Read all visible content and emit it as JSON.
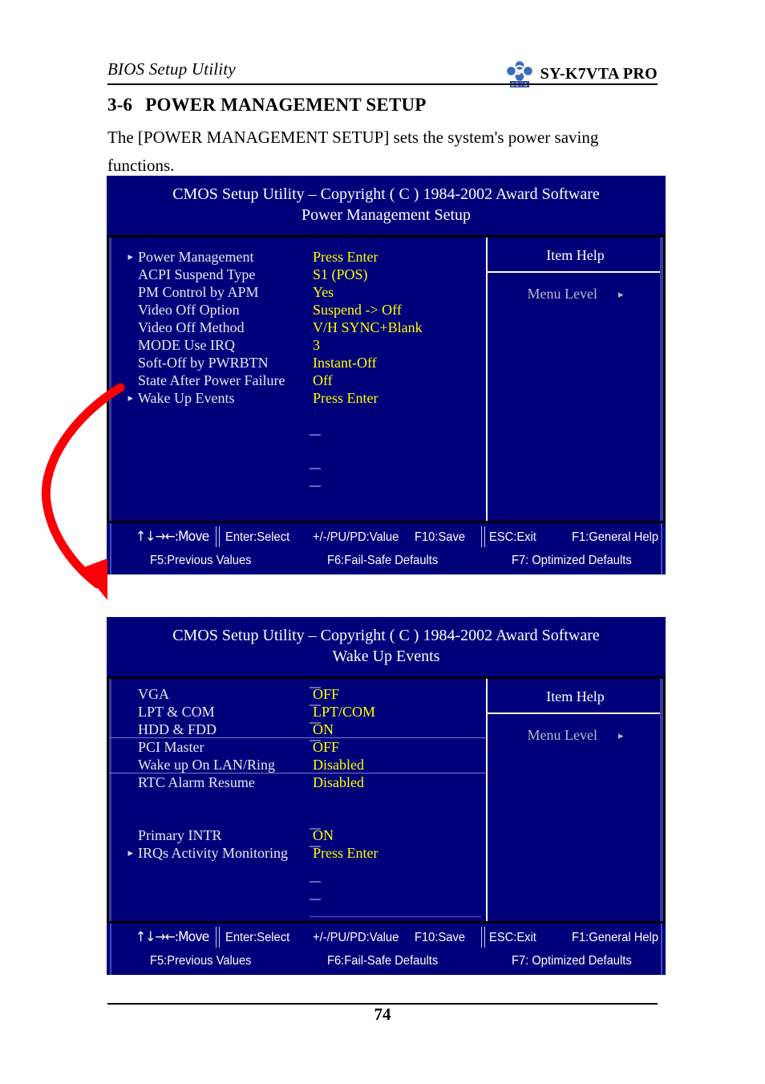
{
  "document": {
    "running_head": "BIOS Setup Utility",
    "model": "SY-K7VTA PRO",
    "logo_text": "SOYO",
    "logo_letter": "S",
    "section_number": "3-6",
    "section_title": "POWER MANAGEMENT SETUP",
    "intro": "The [POWER MANAGEMENT SETUP] sets the system's power saving functions.",
    "page_number": "74"
  },
  "colors": {
    "bios_background": "#00007b",
    "label_text": "#e8e8f0",
    "value_text": "#ffff00",
    "help_text": "#b8b8c8",
    "annotation_arrow": "#fb0007"
  },
  "screens": [
    {
      "title_line1": "CMOS Setup Utility – Copyright ( C ) 1984-2002 Award Software",
      "title_line2": "Power Management Setup",
      "items": [
        {
          "marker": "▸",
          "label": "Power Management",
          "value": "Press Enter"
        },
        {
          "marker": "",
          "label": "ACPI Suspend Type",
          "value": "S1 (POS)"
        },
        {
          "marker": "",
          "label": "PM Control by APM",
          "value": "Yes"
        },
        {
          "marker": "",
          "label": "Video Off Option",
          "value": "Suspend -> Off"
        },
        {
          "marker": "",
          "label": "Video Off Method",
          "value": "V/H SYNC+Blank"
        },
        {
          "marker": "",
          "label": "MODE Use IRQ",
          "value": "3"
        },
        {
          "marker": "",
          "label": "Soft-Off by PWRBTN",
          "value": "Instant-Off"
        },
        {
          "marker": "",
          "label": "State After Power Failure",
          "value": "Off"
        },
        {
          "marker": "▸",
          "label": "Wake Up Events",
          "value": "Press Enter"
        }
      ],
      "help": {
        "title": "Item Help",
        "menu_level_label": "Menu Level",
        "menu_level_marker": "▸"
      }
    },
    {
      "title_line1": "CMOS Setup Utility – Copyright ( C ) 1984-2002 Award Software",
      "title_line2": "Wake Up Events",
      "items": [
        {
          "marker": "",
          "label": "VGA",
          "value": "OFF"
        },
        {
          "marker": "",
          "label": "LPT & COM",
          "value": "LPT/COM"
        },
        {
          "marker": "",
          "label": "HDD & FDD",
          "value": "ON"
        },
        {
          "marker": "",
          "label": "PCI Master",
          "value": "OFF"
        },
        {
          "marker": "",
          "label": "Wake up On LAN/Ring",
          "value": "Disabled"
        },
        {
          "marker": "",
          "label": "RTC Alarm Resume",
          "value": "Disabled"
        },
        {
          "marker": "",
          "label": "",
          "value": ""
        },
        {
          "marker": "",
          "label": "Primary INTR",
          "value": "ON"
        },
        {
          "marker": "▸",
          "label": "IRQs Activity Monitoring",
          "value": "Press Enter"
        }
      ],
      "help": {
        "title": "Item Help",
        "menu_level_label": "Menu Level",
        "menu_level_marker": "▸"
      }
    }
  ],
  "footer_keys": {
    "move": ":Move",
    "move_arrows": "↑↓→←",
    "enter_select": "Enter:Select",
    "value": "+/-/PU/PD:Value",
    "save": "F10:Save",
    "esc_exit": "ESC:Exit",
    "general_help": "F1:General Help",
    "previous_values": "F5:Previous Values",
    "fail_safe": "F6:Fail-Safe Defaults",
    "optimized": "F7: Optimized Defaults"
  }
}
